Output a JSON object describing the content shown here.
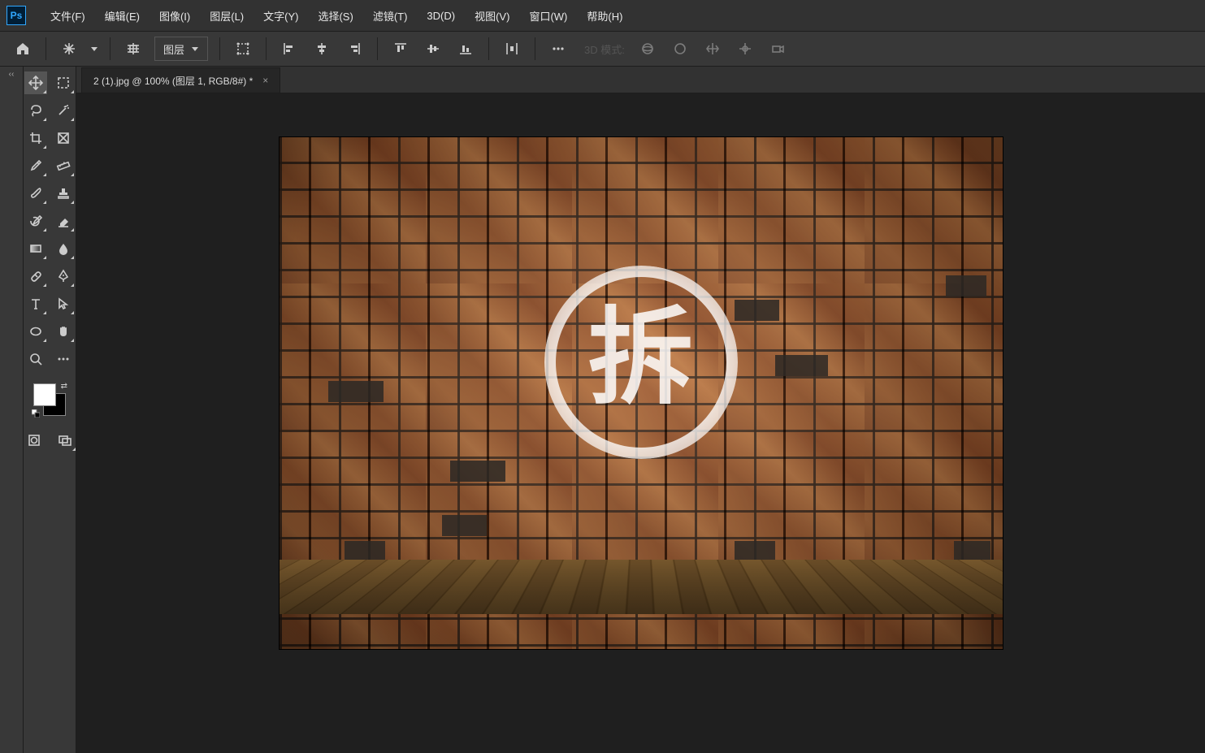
{
  "menubar": {
    "items": [
      "文件(F)",
      "编辑(E)",
      "图像(I)",
      "图层(L)",
      "文字(Y)",
      "选择(S)",
      "滤镜(T)",
      "3D(D)",
      "视图(V)",
      "窗口(W)",
      "帮助(H)"
    ]
  },
  "optionbar": {
    "auto_select_label": "图层",
    "mode3d_label": "3D 模式:"
  },
  "document": {
    "tab_title": "2 (1).jpg @ 100% (图层 1, RGB/8#) *",
    "chai_char": "拆"
  },
  "tools": {
    "left": [
      "move",
      "lasso",
      "crop",
      "eyedropper",
      "brush",
      "history-brush",
      "gradient",
      "spot-heal",
      "text",
      "ellipse",
      "zoom"
    ],
    "right": [
      "marquee",
      "magic-wand",
      "frame",
      "ruler",
      "stamp",
      "eraser",
      "blur",
      "pen",
      "path-select",
      "hand",
      "more"
    ]
  }
}
